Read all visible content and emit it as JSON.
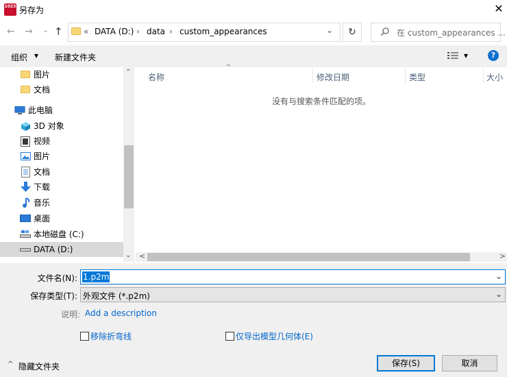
{
  "window": {
    "app_icon_text": "1023",
    "title": "另存为",
    "close_symbol": "✕"
  },
  "nav": {
    "back_symbol": "←",
    "forward_symbol": "→",
    "dropdown_symbol": "⌄",
    "up_symbol": "↑",
    "breadcrumb_overflow": "«",
    "breadcrumb": [
      "DATA (D:)",
      "data",
      "custom_appearances"
    ],
    "separator": "›",
    "refresh_symbol": "↻",
    "search_placeholder": "在 custom_appearances ..."
  },
  "toolbar": {
    "organize_label": "组织",
    "organize_arrow": "▾",
    "new_folder_label": "新建文件夹",
    "view_arrow": "▾",
    "help_symbol": "?"
  },
  "tree": {
    "items": [
      {
        "label": "图片",
        "icon": "folder-icon"
      },
      {
        "label": "文档",
        "icon": "folder-icon"
      },
      {
        "label": "此电脑",
        "icon": "computer-icon"
      },
      {
        "label": "3D 对象",
        "icon": "cube-icon"
      },
      {
        "label": "视频",
        "icon": "video-icon"
      },
      {
        "label": "图片",
        "icon": "picture-icon"
      },
      {
        "label": "文档",
        "icon": "document-icon"
      },
      {
        "label": "下载",
        "icon": "download-icon"
      },
      {
        "label": "音乐",
        "icon": "music-icon"
      },
      {
        "label": "桌面",
        "icon": "desktop-icon"
      },
      {
        "label": "本地磁盘 (C:)",
        "icon": "drive-icon"
      },
      {
        "label": "DATA (D:)",
        "icon": "drive-icon"
      }
    ],
    "scroll_up": "⌃",
    "scroll_down": "⌄"
  },
  "list": {
    "sort_indicator": "^",
    "columns": [
      "名称",
      "修改日期",
      "类型",
      "大小"
    ],
    "empty_message": "没有与搜索条件匹配的项。",
    "scroll_left": "<",
    "scroll_right": ">"
  },
  "form": {
    "filename_label": "文件名(N):",
    "filename_value": "1.p2m",
    "filetype_label": "保存类型(T):",
    "filetype_value": "外观文件 (*.p2m)",
    "description_label": "说明:",
    "description_link": "Add a description",
    "dropdown_symbol": "⌄",
    "checkbox1_label": "移除折弯线",
    "checkbox2_label": "仅导出模型几何体(E)",
    "hide_folders_label": "隐藏文件夹",
    "hide_folders_arrow": "^",
    "save_label": "保存(S)",
    "cancel_label": "取消"
  },
  "colors": {
    "accent": "#0078d7",
    "selection": "#d9d9d9",
    "link": "#0066cc",
    "folder": "#f8d775",
    "app_icon": "#c8102e"
  }
}
